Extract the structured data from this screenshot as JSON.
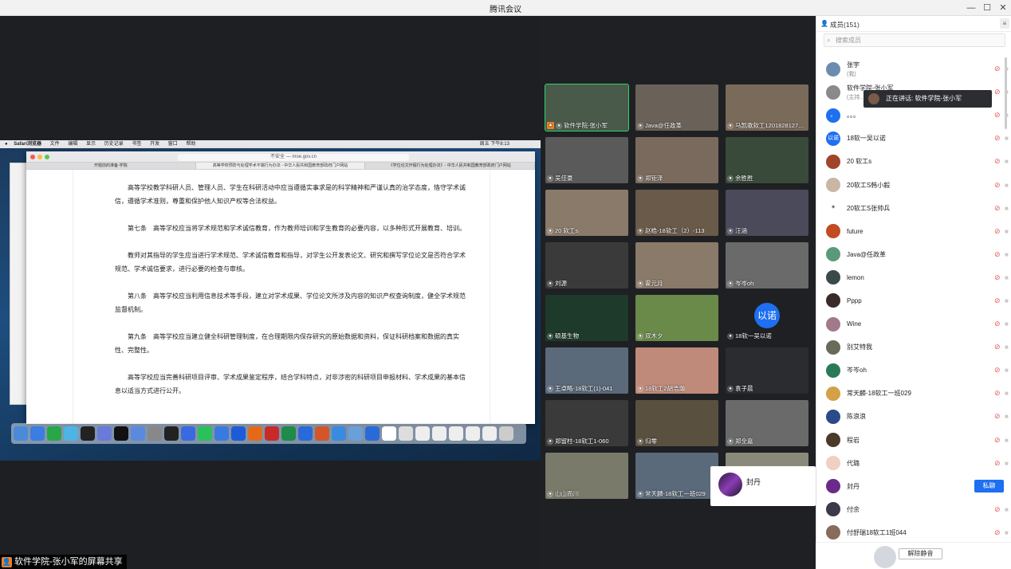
{
  "window": {
    "title": "腾讯会议",
    "minimize": "—",
    "maximize": "☐",
    "close": "✕"
  },
  "share": {
    "label": "软件学院-张小军的屏幕共享",
    "mac_menubar": {
      "apple": "",
      "items": [
        "Safari浏览器",
        "文件",
        "编辑",
        "显示",
        "历史记录",
        "书签",
        "开发",
        "窗口",
        "帮助"
      ],
      "right": "周五 下午8:13"
    },
    "safari": {
      "url": "不安全 — moe.gov.cn",
      "tabs": [
        "开题前的准备-学院",
        "高等学校预防与处理学术不端行为办法 - 中华人民共和国教育部政府门户网站",
        "《学位论文作假行为处理办法》- 中华人民共和国教育部政府门户网站"
      ]
    },
    "doc_paragraphs": [
      "高等学校教学科研人员、管理人员、学生在科研活动中应当遵循实事求是的科学精神和严谨认真的治学态度，恪守学术诚信，遵循学术准则，尊重和保护他人知识产权等合法权益。",
      "第七条　高等学校应当将学术规范和学术诚信教育，作为教师培训和学生教育的必要内容，以多种形式开展教育、培训。",
      "教师对其指导的学生应当进行学术规范、学术诚信教育和指导，对学生公开发表论文、研究和撰写学位论文是否符合学术规范、学术诚信要求，进行必要的检查与审核。",
      "第八条　高等学校应当利用信息技术等手段，建立对学术成果、学位论文所涉及内容的知识产权查询制度，健全学术规范监督机制。",
      "第九条　高等学校应当建立健全科研管理制度，在合理期限内保存研究的原始数据和资料，保证科研档案和数据的真实性、完整性。",
      "高等学校应当完善科研项目评审、学术成果鉴定程序，结合学科特点，对非涉密的科研项目申报材料、学术成果的基本信息以适当方式进行公开。"
    ]
  },
  "tiles": [
    {
      "name": "软件学院-张小军",
      "host": true
    },
    {
      "name": "Java@任政革"
    },
    {
      "name": "马凯歌软工1201828127..."
    },
    {
      "name": "吴佳豪"
    },
    {
      "name": "郑钜泽"
    },
    {
      "name": "余胜胜"
    },
    {
      "name": "20 软工s"
    },
    {
      "name": "赵皓-18软工（2）-113"
    },
    {
      "name": "汪涵"
    },
    {
      "name": "刘源"
    },
    {
      "name": "霍元月"
    },
    {
      "name": "岑岑oh"
    },
    {
      "name": "硕基生物"
    },
    {
      "name": "双木夕"
    },
    {
      "name": "18软一吴以诺",
      "avatar_text": "以诺"
    },
    {
      "name": "王卓略-18软工(1)-041"
    },
    {
      "name": "18软工2胡浩瀚"
    },
    {
      "name": "袁子晨"
    },
    {
      "name": "郑留柱-18软工1-060"
    },
    {
      "name": "归零"
    },
    {
      "name": "郑全嘉"
    },
    {
      "name": "山山而川"
    },
    {
      "name": "常天麟-18软工一班029"
    },
    {
      "name": ""
    }
  ],
  "popup": {
    "name": "封丹"
  },
  "panel": {
    "title": "成员(151)",
    "search_placeholder": "搜索成员",
    "tooltip": "正在讲话: 软件学院-张小军",
    "private_chat": "私聊",
    "unmute_btn": "解除静音",
    "members": [
      {
        "name": "张宇",
        "sub": "(我)",
        "color": "#6a8caf"
      },
      {
        "name": "软件学院-张小军",
        "sub": "(主持...",
        "color": "#8a8a8a"
      },
      {
        "name": "。。。",
        "color": "#1e6ff1",
        "avatar_text": "。"
      },
      {
        "name": "18软一吴以诺",
        "color": "#1e6ff1",
        "avatar_text": "以诺"
      },
      {
        "name": "20 软工s",
        "color": "#a0442a"
      },
      {
        "name": "20软工S韩小毅",
        "color": "#c9b6a4"
      },
      {
        "name": "20软工S张帅兵",
        "color": "#ffffff",
        "avatar_text": "✶"
      },
      {
        "name": "future",
        "color": "#c24b22"
      },
      {
        "name": "Java@任政革",
        "color": "#5a9a7a"
      },
      {
        "name": "lemon",
        "color": "#3a4a4a"
      },
      {
        "name": "Pppp",
        "color": "#3a2a2a"
      },
      {
        "name": "Wine",
        "color": "#a07a8a"
      },
      {
        "name": "别艾特我",
        "color": "#6a6a5a"
      },
      {
        "name": "岑岑oh",
        "color": "#2a7a5a"
      },
      {
        "name": "常天麟-18软工一班029",
        "color": "#d4a048"
      },
      {
        "name": "陈浪浪",
        "color": "#2a4a8a"
      },
      {
        "name": "程岩",
        "color": "#4a3a2a"
      },
      {
        "name": "代璐",
        "color": "#f0d0c0"
      },
      {
        "name": "封丹",
        "color": "#6a2a8a",
        "pm": true
      },
      {
        "name": "付余",
        "color": "#3a3a4a"
      },
      {
        "name": "付舒瑞18软工1班044",
        "color": "#8a6a5a"
      }
    ]
  }
}
